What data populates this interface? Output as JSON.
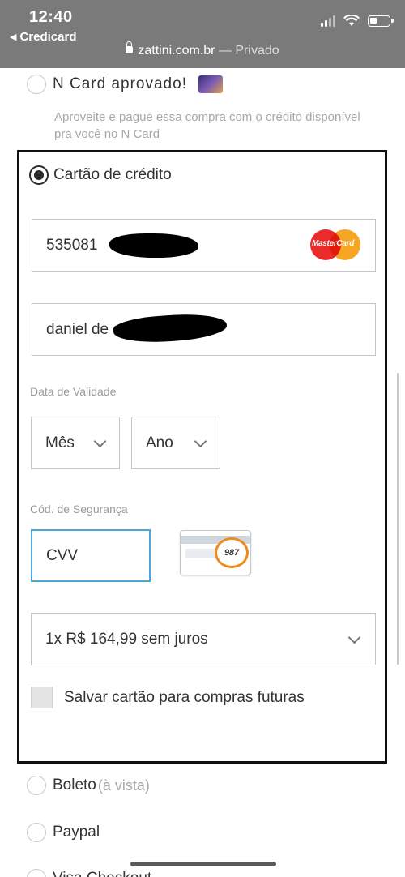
{
  "statusbar": {
    "time": "12:40",
    "back_app": "Credicard",
    "url": "zattini.com.br",
    "mode": "— Privado"
  },
  "payment": {
    "ncard": {
      "label": "N Card aprovado!",
      "description": "Aproveite e pague essa compra com o crédito disponível pra você no N Card"
    },
    "credit_card": {
      "label": "Cartão de crédito",
      "card_number": "535081",
      "card_brand": "MasterCard",
      "card_name": "daniel de c",
      "expiry_label": "Data de Validade",
      "month_label": "Mês",
      "year_label": "Ano",
      "cvv_label": "Cód. de Segurança",
      "cvv_value": "CVV",
      "cvv_example": "987",
      "installments": "1x R$ 164,99 sem juros",
      "save_card": "Salvar cartão para compras futuras"
    },
    "boleto": {
      "label": "Boleto",
      "sub": "(à vista)"
    },
    "paypal": {
      "label": "Paypal"
    },
    "visa": {
      "label": "Visa Checkout"
    }
  },
  "colors": {
    "statusbar_bg": "#7a7a7a",
    "focus_border": "#4fa6d9",
    "mastercard_red": "#eb2a2a",
    "mastercard_orange": "#f6a623"
  }
}
